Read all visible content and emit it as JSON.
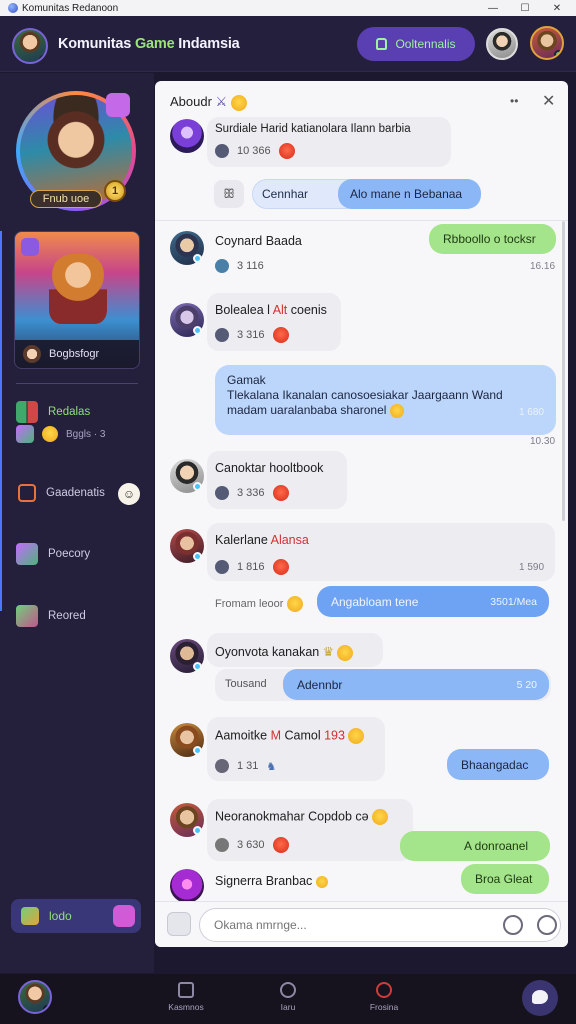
{
  "window": {
    "title": "Komunitas Redanoon",
    "minimize": "—",
    "maximize": "☐",
    "close": "✕"
  },
  "header": {
    "title_main": "Komunitas ",
    "title_accent": "Game",
    "title_rest": " Indamsia",
    "notif_label": "Ooltennalis"
  },
  "sidebar": {
    "profile_badge": "Fnub uoe",
    "profile_rank": "1",
    "game_caption": "Bogbsfogr",
    "items": [
      {
        "label": "Redalas"
      },
      {
        "label": "Gaadenatis"
      },
      {
        "label": "Poecory"
      },
      {
        "label": "Reored"
      }
    ],
    "sub_row": "Bggls  ·  3",
    "emoji_badge": "☺",
    "bottom_pill": "lodo"
  },
  "chat": {
    "title": "Aboudr",
    "header_icon": "⚔",
    "controls": {
      "more": "••",
      "close": "✕"
    },
    "composer_placeholder": "Okama nmrnge...",
    "messages": [
      {
        "text": "Surdiale Harid katianolara Ilann barbia",
        "time": "10 366"
      },
      {
        "chip_a": "ꕥ",
        "chip_b": "Cennhar",
        "reply": "Alo mane n Bebanaa"
      },
      {
        "name": "Coynard Baada",
        "time": "3 116",
        "reply": "Rbboollo o tocksr",
        "reply_time": "16.16"
      },
      {
        "name": "Bolealea l ",
        "name_red": "Alt",
        "name_rest": " coenis",
        "time": "3 316"
      },
      {
        "line1": "Gamak",
        "line2": "Tlekalana Ikanalan canosoesiakar Jaargaann Wand",
        "line3": "madam uaralanbaba sharonel",
        "time": "1 680",
        "outer_time": "10.30"
      },
      {
        "name": "Canoktar hooltbook",
        "time": "3 336"
      },
      {
        "name": "Kalerlane ",
        "name_red": "Alansa",
        "time": "1 816",
        "right_time": "1 590"
      },
      {
        "left": "Fromam leoor",
        "reply": "Angabloam tene",
        "reply_time": "3501/Mea"
      },
      {
        "name": "Oyonvota kanakan",
        "left": "Tousand",
        "reply": "Adennbr",
        "reply_time": "5 20"
      },
      {
        "name": "Aamoitke ",
        "name_red": "M",
        "name_rest": " Camol ",
        "name_num": "193",
        "time": "1 31",
        "reply": "Bhaangadac"
      },
      {
        "name": "Neoranokmahar Copdob",
        "name_tail": " cə",
        "time": "3 630",
        "reply": "A donroanel"
      },
      {
        "name": "Signerra Branbac",
        "reply": "Broa Gleat"
      }
    ]
  },
  "bottom_nav": {
    "items": [
      {
        "label": "Kasmnos"
      },
      {
        "label": "Iaru"
      },
      {
        "label": "Frosina"
      }
    ]
  }
}
